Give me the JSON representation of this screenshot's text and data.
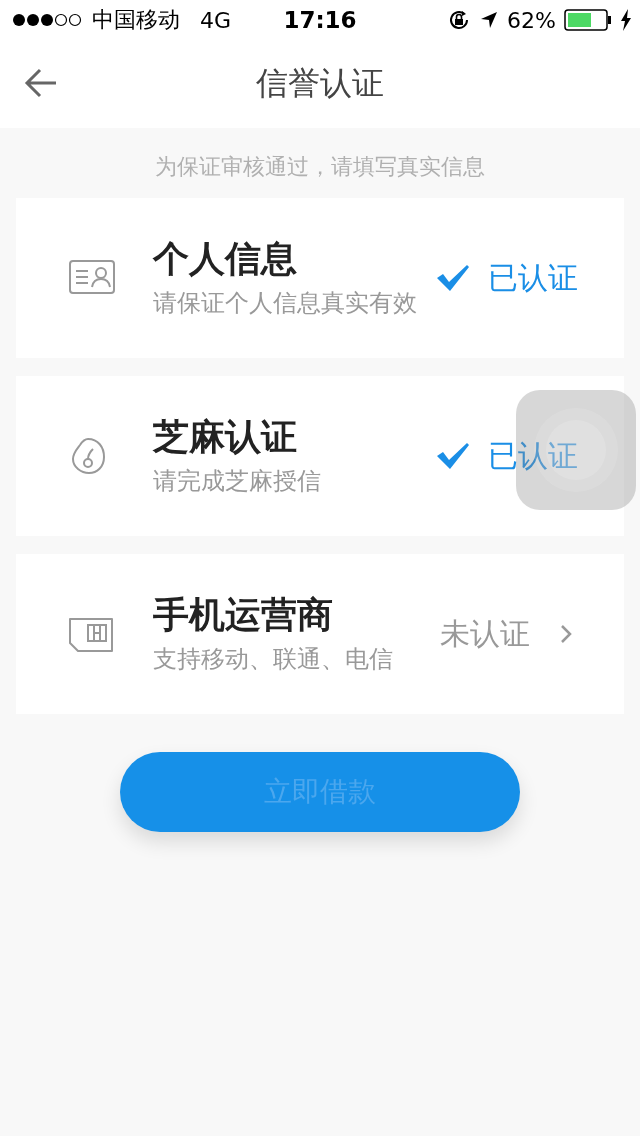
{
  "status_bar": {
    "carrier": "中国移动",
    "network": "4G",
    "time": "17:16",
    "battery": "62%"
  },
  "nav": {
    "title": "信誉认证"
  },
  "hint": "为保证审核通过，请填写真实信息",
  "items": [
    {
      "title": "个人信息",
      "subtitle": "请保证个人信息真实有效",
      "status": "已认证",
      "verified": true
    },
    {
      "title": "芝麻认证",
      "subtitle": "请完成芝麻授信",
      "status": "已认证",
      "verified": true
    },
    {
      "title": "手机运营商",
      "subtitle": "支持移动、联通、电信",
      "status": "未认证",
      "verified": false
    }
  ],
  "action_button": {
    "label": "立即借款",
    "disabled": true
  }
}
